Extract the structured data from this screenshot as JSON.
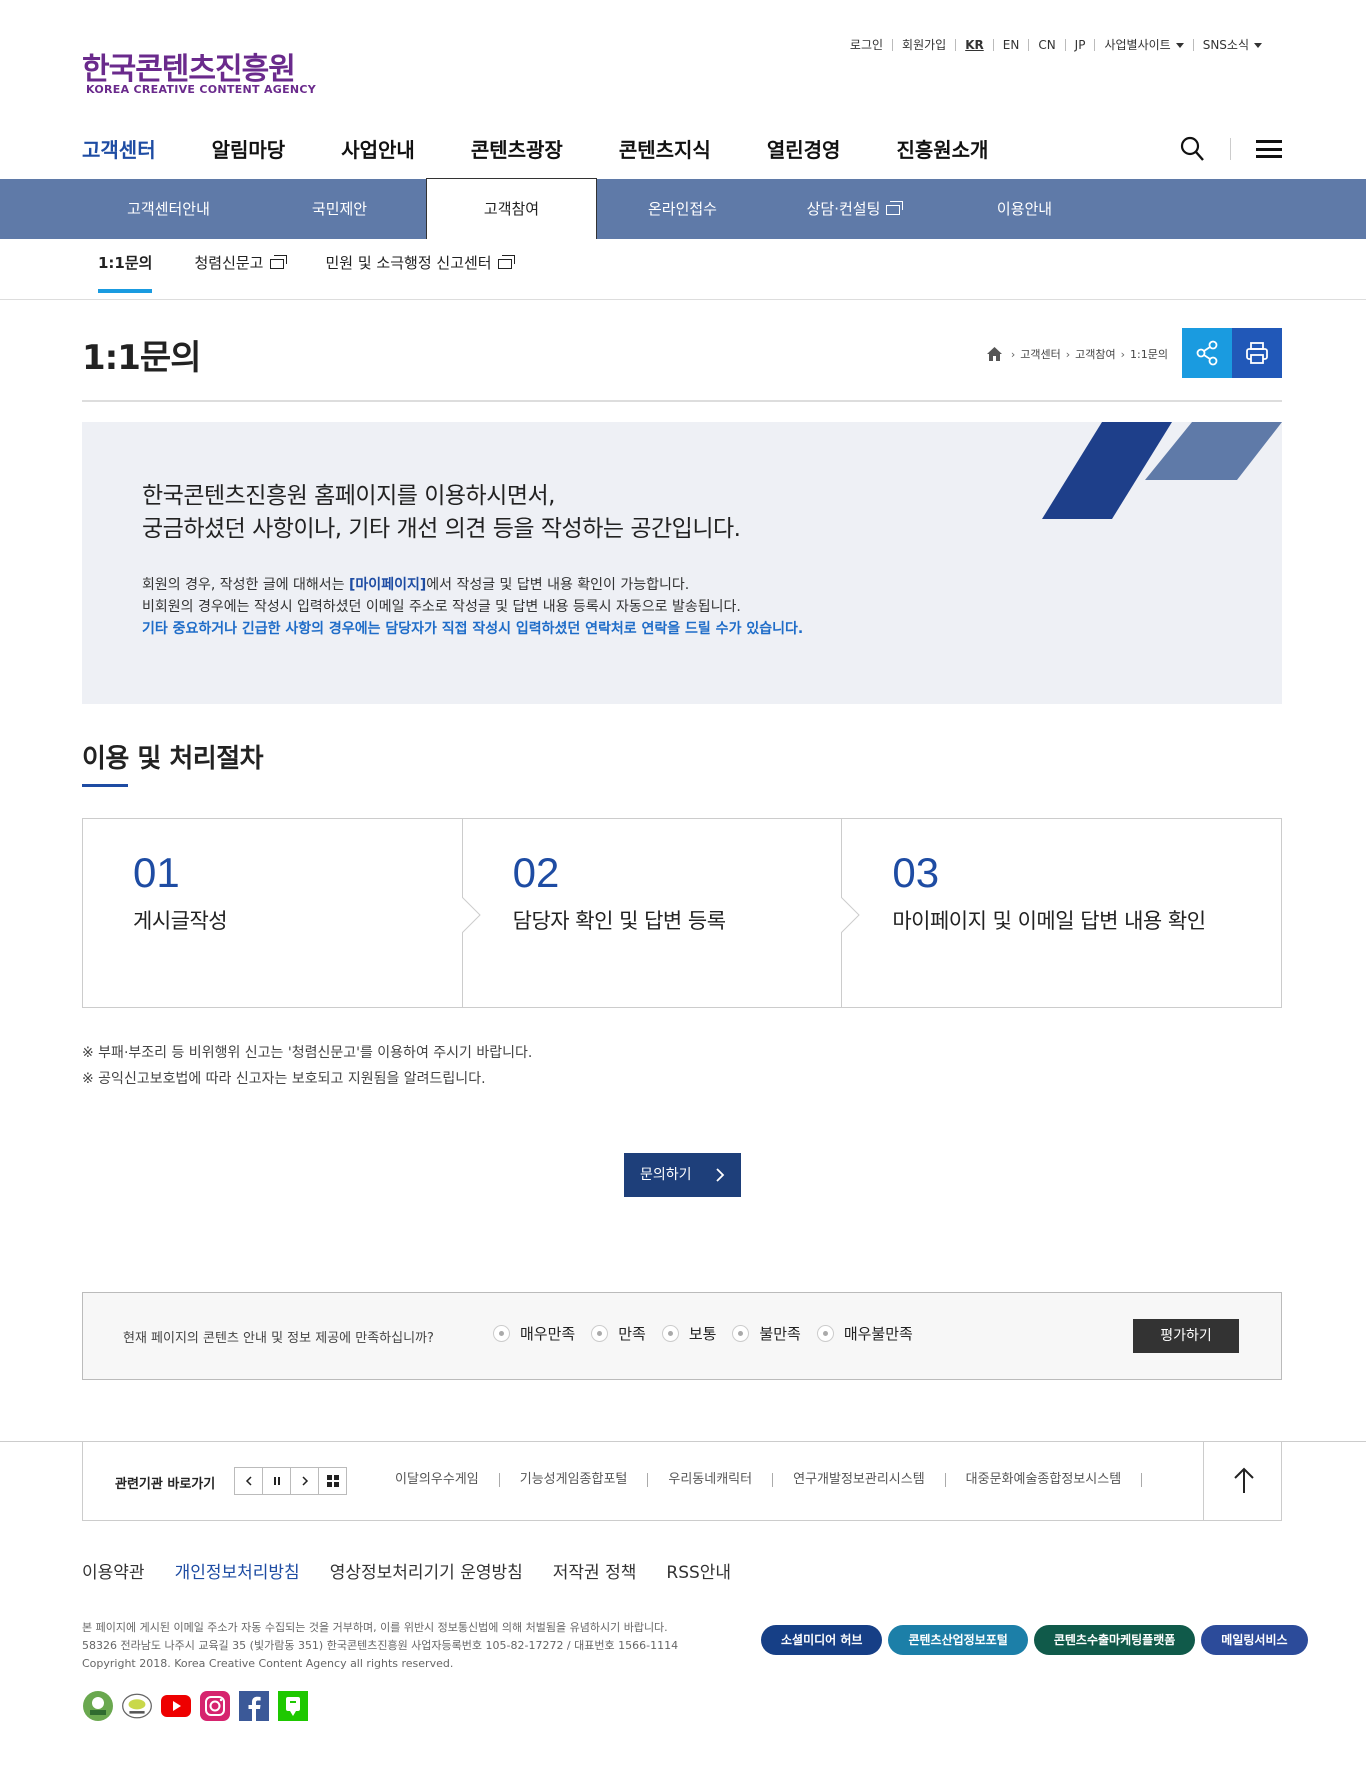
{
  "header": {
    "logo_ko": "한국콘텐츠진흥원",
    "logo_en": "KOREA CREATIVE CONTENT AGENCY",
    "util": [
      "로그인",
      "회원가입",
      "KR",
      "EN",
      "CN",
      "JP",
      "사업별사이트",
      "SNS소식"
    ],
    "gnb": [
      "고객센터",
      "알림마당",
      "사업안내",
      "콘텐츠광장",
      "콘텐츠지식",
      "열린경영",
      "진흥원소개"
    ]
  },
  "lnb": [
    "고객센터안내",
    "국민제안",
    "고객참여",
    "온라인접수",
    "상담·컨설팅",
    "이용안내"
  ],
  "tabs": [
    "1:1문의",
    "청렴신문고",
    "민원 및 소극행정 신고센터"
  ],
  "page": {
    "title": "1:1문의",
    "breadcrumb": [
      "고객센터",
      "고객참여",
      "1:1문의"
    ]
  },
  "intro": {
    "line1": "한국콘텐츠진흥원 홈페이지를 이용하시면서,",
    "line2": "궁금하셨던 사항이나, 기타 개선 의견 등을 작성하는 공간입니다.",
    "p1_a": "회원의 경우, 작성한 글에 대해서는 ",
    "p1_link": "[마이페이지]",
    "p1_b": "에서 작성글 및 답변 내용 확인이 가능합니다.",
    "p2": "비회원의 경우에는 작성시 입력하셨던 이메일 주소로 작성글 및 답변 내용 등록시 자동으로 발송됩니다.",
    "p3": "기타 중요하거나 긴급한 사항의 경우에는 담당자가 직접 작성시 입력하셨던 연락처로 연락을 드릴 수가 있습니다."
  },
  "process": {
    "title": "이용 및 처리절차",
    "steps": [
      {
        "num": "01",
        "text": "게시글작성"
      },
      {
        "num": "02",
        "text": "담당자 확인 및 답변 등록"
      },
      {
        "num": "03",
        "text": "마이페이지 및 이메일 답변 내용 확인"
      }
    ]
  },
  "notes": [
    "※ 부패·부조리 등 비위행위 신고는 '청렴신문고'를 이용하여 주시기 바랍니다.",
    "※ 공익신고보호법에 따라 신고자는 보호되고 지원됨을 알려드립니다."
  ],
  "ask_button": "문의하기",
  "survey": {
    "question": "현재 페이지의 콘텐츠 안내 및 정보 제공에 만족하십니까?",
    "options": [
      "매우만족",
      "만족",
      "보통",
      "불만족",
      "매우불만족"
    ],
    "submit": "평가하기"
  },
  "related": {
    "label": "관련기관 바로가기",
    "links": [
      "이달의우수게임",
      "기능성게임종합포털",
      "우리동네캐릭터",
      "연구개발정보관리시스템",
      "대중문화예술종합정보시스템"
    ]
  },
  "footer": {
    "policy": [
      "이용약관",
      "개인정보처리방침",
      "영상정보처리기기 운영방침",
      "저작권 정책",
      "RSS안내"
    ],
    "text1": "본 페이지에 게시된 이메일 주소가 자동 수집되는 것을 거부하며, 이를 위반시 정보통신법에 의해 처벌됨을 유념하시기 바랍니다.",
    "text2": "58326 전라남도 나주시 교육길 35 (빛가람동 351) 한국콘텐츠진흥원 사업자등록번호 105-82-17272 / 대표번호 1566-1114",
    "text3": "Copyright 2018. Korea Creative Content Agency all rights reserved.",
    "buttons": [
      {
        "label": "소셜미디어 허브",
        "color": "#163f86"
      },
      {
        "label": "콘텐츠산업정보포털",
        "color": "#1c7fa8"
      },
      {
        "label": "콘텐츠수출마케팅플랫폼",
        "color": "#105a4a"
      },
      {
        "label": "메일링서비스",
        "color": "#2c4b9a"
      }
    ]
  },
  "colors": {
    "brand_purple": "#6a2a8c",
    "primary_blue": "#1e4ca3",
    "lnb_bg": "#5f7aa8",
    "share": "#1a9be0",
    "print": "#2158b8"
  }
}
